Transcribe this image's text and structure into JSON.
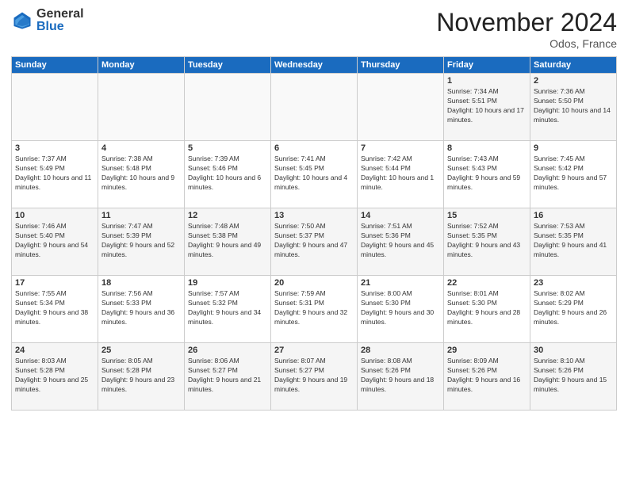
{
  "logo": {
    "general": "General",
    "blue": "Blue"
  },
  "header": {
    "title": "November 2024",
    "location": "Odos, France"
  },
  "weekdays": [
    "Sunday",
    "Monday",
    "Tuesday",
    "Wednesday",
    "Thursday",
    "Friday",
    "Saturday"
  ],
  "weeks": [
    [
      {
        "day": "",
        "info": ""
      },
      {
        "day": "",
        "info": ""
      },
      {
        "day": "",
        "info": ""
      },
      {
        "day": "",
        "info": ""
      },
      {
        "day": "",
        "info": ""
      },
      {
        "day": "1",
        "info": "Sunrise: 7:34 AM\nSunset: 5:51 PM\nDaylight: 10 hours and 17 minutes."
      },
      {
        "day": "2",
        "info": "Sunrise: 7:36 AM\nSunset: 5:50 PM\nDaylight: 10 hours and 14 minutes."
      }
    ],
    [
      {
        "day": "3",
        "info": "Sunrise: 7:37 AM\nSunset: 5:49 PM\nDaylight: 10 hours and 11 minutes."
      },
      {
        "day": "4",
        "info": "Sunrise: 7:38 AM\nSunset: 5:48 PM\nDaylight: 10 hours and 9 minutes."
      },
      {
        "day": "5",
        "info": "Sunrise: 7:39 AM\nSunset: 5:46 PM\nDaylight: 10 hours and 6 minutes."
      },
      {
        "day": "6",
        "info": "Sunrise: 7:41 AM\nSunset: 5:45 PM\nDaylight: 10 hours and 4 minutes."
      },
      {
        "day": "7",
        "info": "Sunrise: 7:42 AM\nSunset: 5:44 PM\nDaylight: 10 hours and 1 minute."
      },
      {
        "day": "8",
        "info": "Sunrise: 7:43 AM\nSunset: 5:43 PM\nDaylight: 9 hours and 59 minutes."
      },
      {
        "day": "9",
        "info": "Sunrise: 7:45 AM\nSunset: 5:42 PM\nDaylight: 9 hours and 57 minutes."
      }
    ],
    [
      {
        "day": "10",
        "info": "Sunrise: 7:46 AM\nSunset: 5:40 PM\nDaylight: 9 hours and 54 minutes."
      },
      {
        "day": "11",
        "info": "Sunrise: 7:47 AM\nSunset: 5:39 PM\nDaylight: 9 hours and 52 minutes."
      },
      {
        "day": "12",
        "info": "Sunrise: 7:48 AM\nSunset: 5:38 PM\nDaylight: 9 hours and 49 minutes."
      },
      {
        "day": "13",
        "info": "Sunrise: 7:50 AM\nSunset: 5:37 PM\nDaylight: 9 hours and 47 minutes."
      },
      {
        "day": "14",
        "info": "Sunrise: 7:51 AM\nSunset: 5:36 PM\nDaylight: 9 hours and 45 minutes."
      },
      {
        "day": "15",
        "info": "Sunrise: 7:52 AM\nSunset: 5:35 PM\nDaylight: 9 hours and 43 minutes."
      },
      {
        "day": "16",
        "info": "Sunrise: 7:53 AM\nSunset: 5:35 PM\nDaylight: 9 hours and 41 minutes."
      }
    ],
    [
      {
        "day": "17",
        "info": "Sunrise: 7:55 AM\nSunset: 5:34 PM\nDaylight: 9 hours and 38 minutes."
      },
      {
        "day": "18",
        "info": "Sunrise: 7:56 AM\nSunset: 5:33 PM\nDaylight: 9 hours and 36 minutes."
      },
      {
        "day": "19",
        "info": "Sunrise: 7:57 AM\nSunset: 5:32 PM\nDaylight: 9 hours and 34 minutes."
      },
      {
        "day": "20",
        "info": "Sunrise: 7:59 AM\nSunset: 5:31 PM\nDaylight: 9 hours and 32 minutes."
      },
      {
        "day": "21",
        "info": "Sunrise: 8:00 AM\nSunset: 5:30 PM\nDaylight: 9 hours and 30 minutes."
      },
      {
        "day": "22",
        "info": "Sunrise: 8:01 AM\nSunset: 5:30 PM\nDaylight: 9 hours and 28 minutes."
      },
      {
        "day": "23",
        "info": "Sunrise: 8:02 AM\nSunset: 5:29 PM\nDaylight: 9 hours and 26 minutes."
      }
    ],
    [
      {
        "day": "24",
        "info": "Sunrise: 8:03 AM\nSunset: 5:28 PM\nDaylight: 9 hours and 25 minutes."
      },
      {
        "day": "25",
        "info": "Sunrise: 8:05 AM\nSunset: 5:28 PM\nDaylight: 9 hours and 23 minutes."
      },
      {
        "day": "26",
        "info": "Sunrise: 8:06 AM\nSunset: 5:27 PM\nDaylight: 9 hours and 21 minutes."
      },
      {
        "day": "27",
        "info": "Sunrise: 8:07 AM\nSunset: 5:27 PM\nDaylight: 9 hours and 19 minutes."
      },
      {
        "day": "28",
        "info": "Sunrise: 8:08 AM\nSunset: 5:26 PM\nDaylight: 9 hours and 18 minutes."
      },
      {
        "day": "29",
        "info": "Sunrise: 8:09 AM\nSunset: 5:26 PM\nDaylight: 9 hours and 16 minutes."
      },
      {
        "day": "30",
        "info": "Sunrise: 8:10 AM\nSunset: 5:26 PM\nDaylight: 9 hours and 15 minutes."
      }
    ]
  ]
}
